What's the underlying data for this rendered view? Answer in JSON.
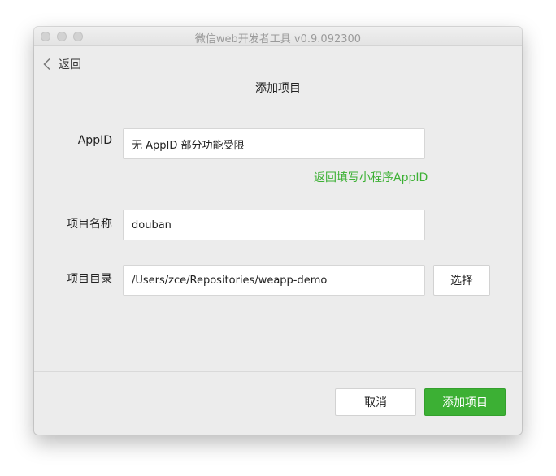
{
  "window": {
    "title": "微信web开发者工具 v0.9.092300"
  },
  "nav": {
    "back_label": "返回"
  },
  "page": {
    "title": "添加项目"
  },
  "form": {
    "appid": {
      "label": "AppID",
      "value": "无 AppID 部分功能受限",
      "link": "返回填写小程序AppID"
    },
    "project_name": {
      "label": "项目名称",
      "value": "douban"
    },
    "project_dir": {
      "label": "项目目录",
      "value": "/Users/zce/Repositories/weapp-demo",
      "choose_label": "选择"
    }
  },
  "footer": {
    "cancel_label": "取消",
    "submit_label": "添加项目"
  },
  "colors": {
    "accent": "#3cb034",
    "window_bg": "#ececec"
  },
  "icons": {
    "back": "chevron-left-icon"
  }
}
